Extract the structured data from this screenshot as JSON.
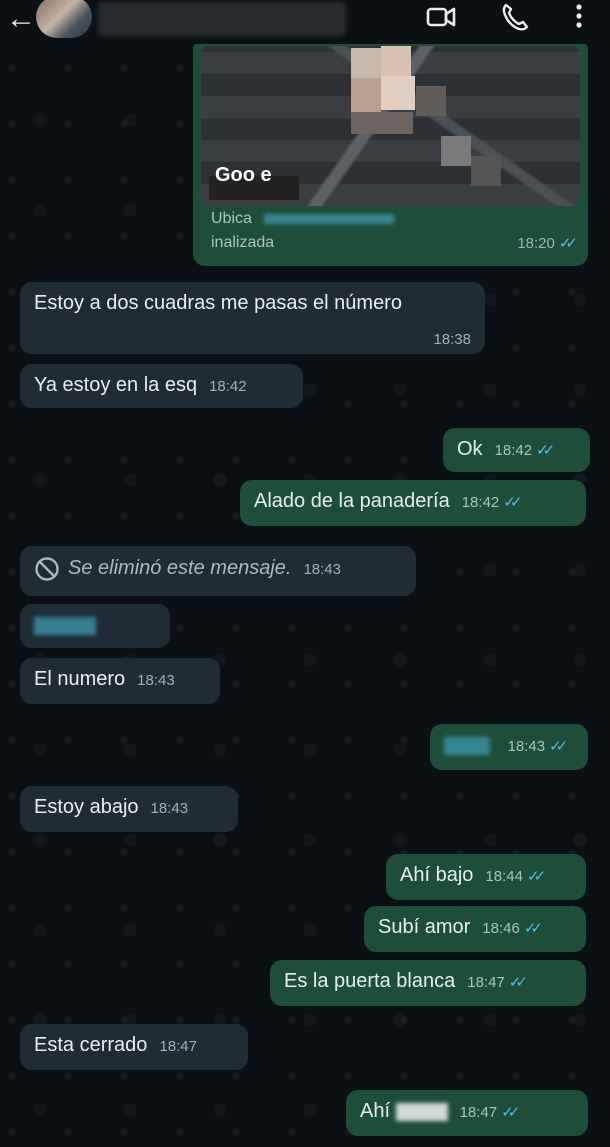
{
  "header": {
    "back_icon": "arrow-left-icon",
    "video_icon": "video-call-icon",
    "call_icon": "phone-icon",
    "menu_icon": "more-vertical-icon"
  },
  "location": {
    "map_word": "Goo  e",
    "addr_line1": "Ubica  ",
    "addr_line2": "inalizada",
    "time": "18:20"
  },
  "messages": [
    {
      "dir": "in",
      "text": "Estoy a dos cuadras me pasas el número",
      "time": "18:38"
    },
    {
      "dir": "in",
      "text": "Ya estoy en la esq",
      "time": "18:42"
    },
    {
      "dir": "out",
      "text": "Ok",
      "time": "18:42"
    },
    {
      "dir": "out",
      "text": "Alado de la panadería",
      "time": "18:42"
    },
    {
      "dir": "in",
      "text": "Se eliminó este mensaje.",
      "time": "18:43",
      "deleted": true
    },
    {
      "dir": "in",
      "text": "",
      "time": ""
    },
    {
      "dir": "in",
      "text": "El numero",
      "time": "18:43"
    },
    {
      "dir": "out",
      "text": "",
      "time": "18:43"
    },
    {
      "dir": "in",
      "text": "Estoy abajo",
      "time": "18:43"
    },
    {
      "dir": "out",
      "text": "Ahí bajo",
      "time": "18:44"
    },
    {
      "dir": "out",
      "text": "Subí amor",
      "time": "18:46"
    },
    {
      "dir": "out",
      "text": "Es la puerta blanca",
      "time": "18:47"
    },
    {
      "dir": "in",
      "text": "Esta cerrado",
      "time": "18:47"
    },
    {
      "dir": "out",
      "text": "Ahí",
      "time": "18:47"
    }
  ],
  "colors": {
    "background": "#0b1014",
    "incoming": "#1f2c33",
    "outgoing": "#1e4d3a",
    "read_tick": "#53bdeb"
  }
}
